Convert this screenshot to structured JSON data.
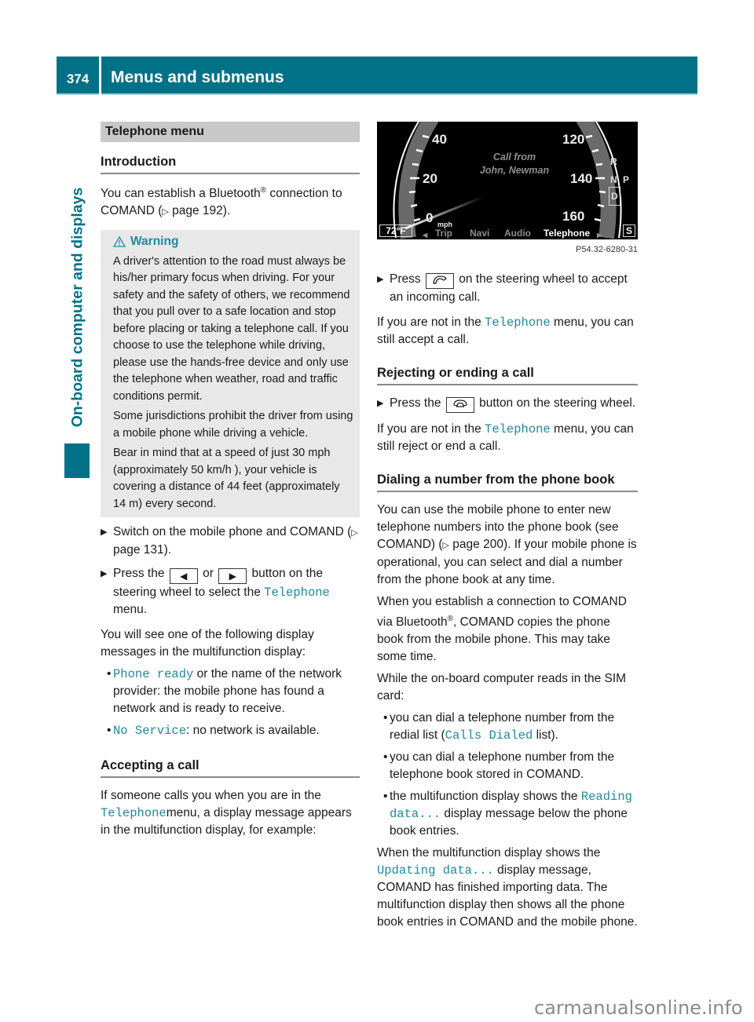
{
  "header": {
    "page_number": "374",
    "title": "Menus and submenus"
  },
  "side_tab": {
    "label": "On-board computer and displays"
  },
  "left": {
    "section_band": "Telephone menu",
    "intro_heading": "Introduction",
    "intro_text_1": "You can establish a Bluetooth",
    "intro_reg": "®",
    "intro_text_2": " connection to COMAND (",
    "intro_ref_arrow": "▷",
    "intro_ref": " page 192).",
    "warning": {
      "title": "Warning",
      "icon": "warning-triangle-icon",
      "paragraphs": [
        "A driver's attention to the road must always be his/her primary focus when driving. For your safety and the safety of others, we recommend that you pull over to a safe location and stop before placing or taking a telephone call. If you choose to use the telephone while driving, please use the hands-free device and only use the telephone when weather, road and traffic conditions permit.",
        "Some jurisdictions prohibit the driver from using a mobile phone while driving a vehicle.",
        "Bear in mind that at a speed of just 30 mph (approximately 50 km/h ), your vehicle is covering a distance of 44 feet (approximately 14 m) every second."
      ]
    },
    "step1": {
      "text": "Switch on the mobile phone and COMAND (",
      "ref_arrow": "▷",
      "ref": " page 131)."
    },
    "step2": {
      "pre": "Press the ",
      "key_left": "◀",
      "or": " or ",
      "key_right": "▶",
      "mid": " button on the steering wheel to select the ",
      "menu": "Telephone",
      "post": " menu."
    },
    "display_intro": "You will see one of the following display messages in the multifunction display:",
    "bullets": [
      {
        "code": "Phone ready",
        "text": " or the name of the network provider: the mobile phone has found a network and is ready to receive."
      },
      {
        "code": "No Service",
        "text": ": no network is available."
      }
    ],
    "accept_heading": "Accepting a call",
    "accept_pre": "If someone calls you when you are in the ",
    "accept_code": "Telephone",
    "accept_post": "menu, a display message appears in the multifunction display, for example:"
  },
  "cluster": {
    "speed_left": [
      "40",
      "20",
      "0"
    ],
    "speed_unit": "mph",
    "speed_right": [
      "120",
      "140",
      "160"
    ],
    "call_line1": "Call from",
    "call_line2": "John, Newman",
    "temperature": "72°F",
    "menu_left_arrow": "◀",
    "menu_items": [
      "Trip",
      "Navi",
      "Audio",
      "Telephone"
    ],
    "active_menu": "Telephone",
    "menu_right_arrow": "▶",
    "gears": [
      "R",
      "N",
      "D"
    ],
    "park": "P",
    "mode": "S",
    "caption": "P54.32-6280-31"
  },
  "right": {
    "accept_step": {
      "pre": "Press ",
      "icon": "phone-accept-icon",
      "post": " on the steering wheel to accept an incoming call."
    },
    "accept_note": {
      "pre": "If you are not in the ",
      "code": "Telephone",
      "post": " menu, you can still accept a call."
    },
    "reject_heading": "Rejecting or ending a call",
    "reject_step": {
      "pre": "Press the ",
      "icon": "phone-hangup-icon",
      "post": " button on the steering wheel."
    },
    "reject_note": {
      "pre": "If you are not in the ",
      "code": "Telephone",
      "post": " menu, you can still reject or end a call."
    },
    "dial_heading": "Dialing a number from the phone book",
    "dial_p1_pre": "You can use the mobile phone to enter new telephone numbers into the phone book (see COMAND) (",
    "dial_p1_arrow": "▷",
    "dial_p1_post": " page 200). If your mobile phone is operational, you can select and dial a number from the phone book at any time.",
    "dial_p2_pre": "When you establish a connection to COMAND via Bluetooth",
    "dial_p2_reg": "®",
    "dial_p2_post": ", COMAND copies the phone book from the mobile phone. This may take some time.",
    "sim_intro": "While the on-board computer reads in the SIM card:",
    "sim_bullets": [
      {
        "pre": "you can dial a telephone number from the redial list (",
        "code": "Calls Dialed",
        "post": " list)."
      },
      {
        "pre": "you can dial a telephone number from the telephone book stored in COMAND.",
        "code": "",
        "post": ""
      },
      {
        "pre": "the multifunction display shows the ",
        "code": "Reading data...",
        "post": " display message below the phone book entries."
      }
    ],
    "update_pre": "When the multifunction display shows the ",
    "update_code": "Updating data...",
    "update_post": " display message, COMAND has finished importing data. The multifunction display then shows all the phone book entries in COMAND and the mobile phone."
  },
  "watermark": "carmanualsonline.info",
  "colors": {
    "brand_teal": "#007187",
    "code_teal": "#1f8a9e",
    "section_band": "#c8c8c8",
    "warning_bg": "#e8e8e8"
  }
}
